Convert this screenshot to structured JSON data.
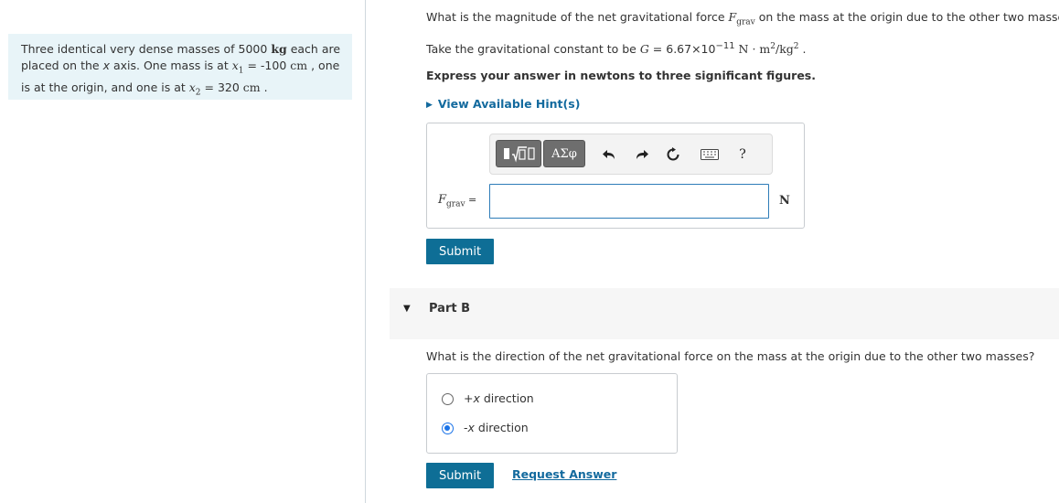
{
  "problem": {
    "s1": "Three identical very dense masses of 5000 ",
    "unit_kg": "kg",
    "s2": " each are placed on the ",
    "x_axis_var": "x",
    "s3": " axis. One mass is at ",
    "x1_var": "x",
    "x1_sub": "1",
    "s4": " = -100 ",
    "unit_cm1": "cm",
    "s5": " , one is at the origin, and one is at ",
    "x2_var": "x",
    "x2_sub": "2",
    "s6": " = 320 ",
    "unit_cm2": "cm",
    "s7": " ."
  },
  "part_a": {
    "q_pre": "What is the magnitude of the net gravitational force ",
    "f_var": "F",
    "f_sub": "grav",
    "q_post": " on the mass at the origin due to the other two masse",
    "g_pre": "Take the gravitational constant to be ",
    "g_var": "G",
    "g_val": " = 6.67×10",
    "g_exp": "−11",
    "g_units": " N · m",
    "g_exp2": "2",
    "g_units2": "/kg",
    "g_exp3": "2",
    "g_end": " .",
    "instruction": "Express your answer in newtons to three significant figures.",
    "hint_label": "View Available Hint(s)",
    "answer_label_var": "F",
    "answer_label_sub": "grav",
    "answer_label_eq": " =",
    "answer_value": "",
    "unit": "N",
    "submit_label": "Submit",
    "toolbar": {
      "greek_label": "ΑΣφ",
      "help_label": "?"
    }
  },
  "part_b": {
    "title": "Part B",
    "question": "What is the direction of the net gravitational force on the mass at the origin due to the other two masses?",
    "options": [
      {
        "pre": "+",
        "var": "x",
        "post": " direction",
        "selected": false
      },
      {
        "pre": "-",
        "var": "x",
        "post": " direction",
        "selected": true
      }
    ],
    "submit_label": "Submit",
    "request_answer_label": "Request Answer"
  },
  "colors": {
    "accent": "#0e6e96",
    "link": "#136a9e",
    "panel_bg": "#e8f4f8",
    "radio_selected": "#1a73e8"
  }
}
